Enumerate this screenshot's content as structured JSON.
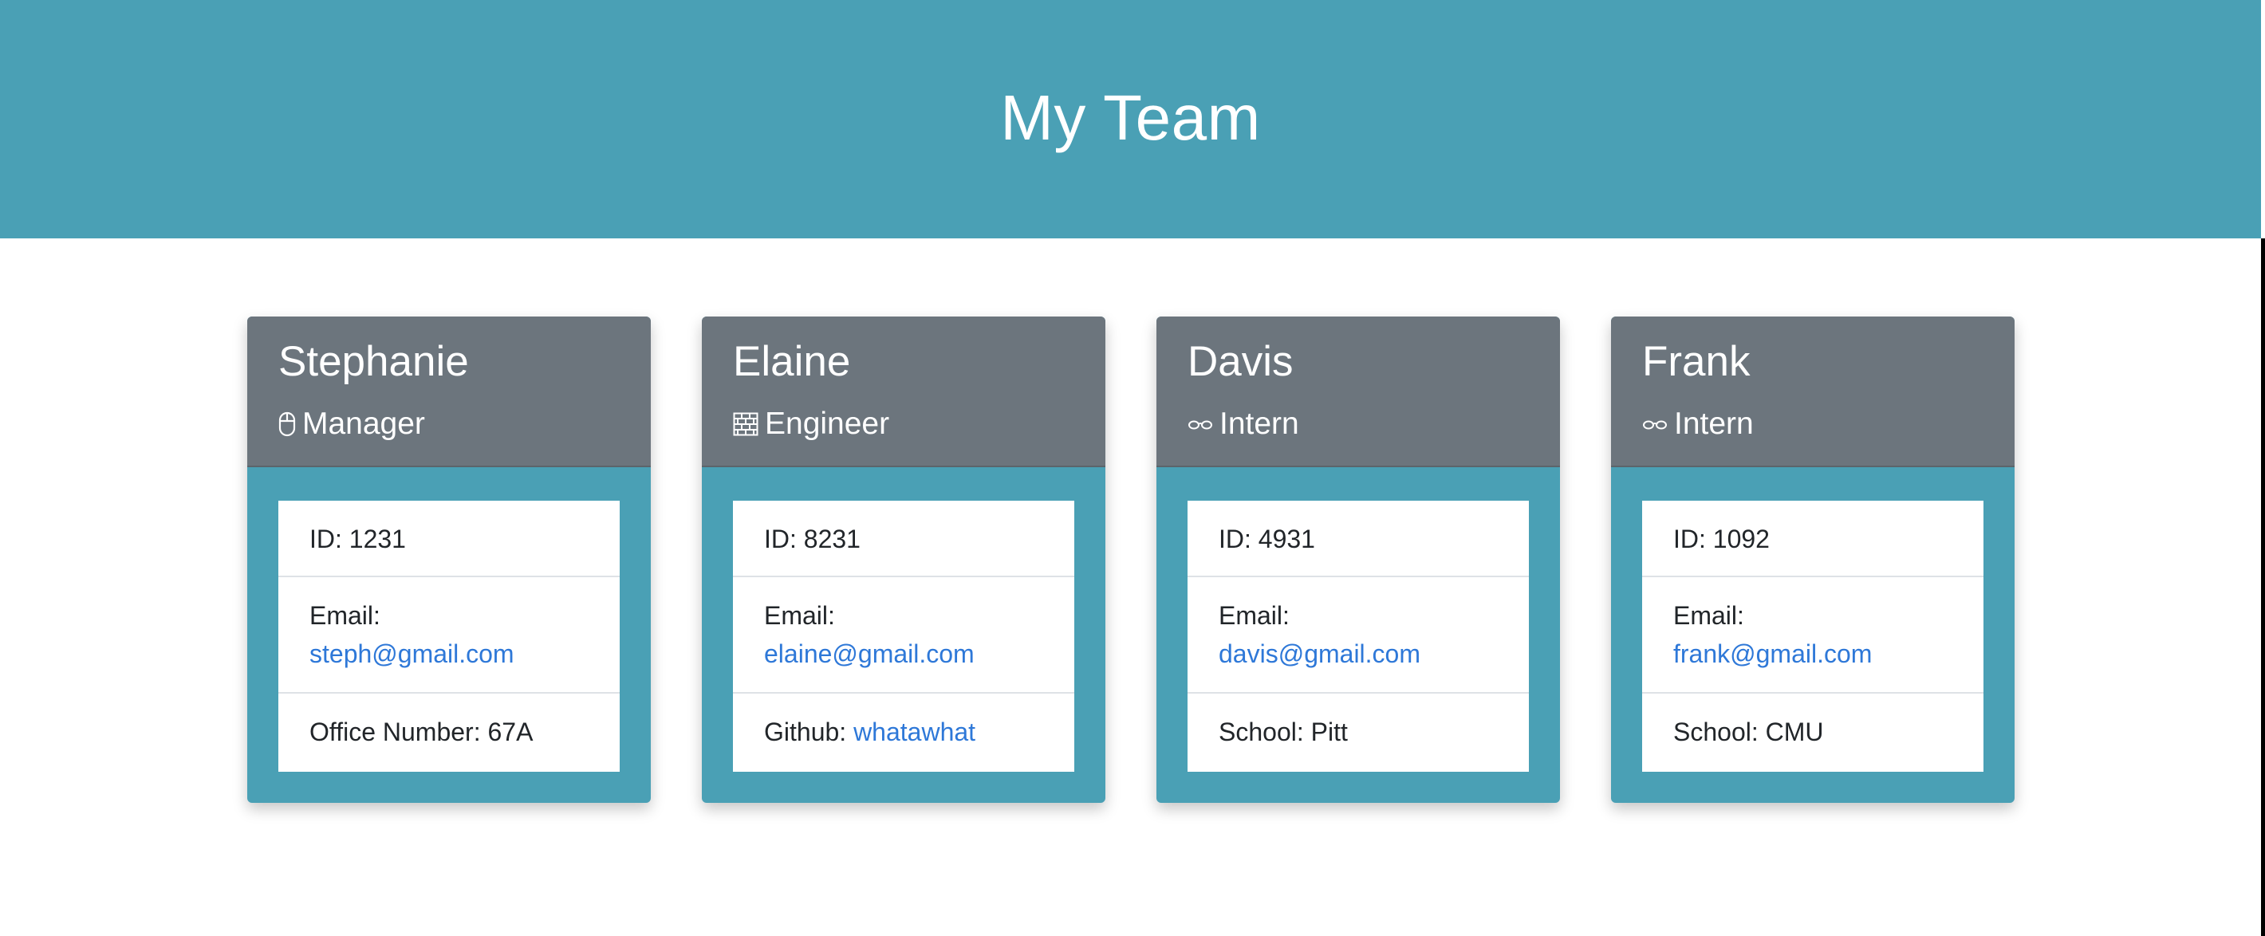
{
  "header": {
    "title": "My Team"
  },
  "employees": [
    {
      "name": "Stephanie",
      "role": "Manager",
      "role_icon": "mouse-icon",
      "id_label": "ID: 1231",
      "email_label": "Email:",
      "email": "steph@gmail.com",
      "extra_label": "Office Number: 67A",
      "extra_link": ""
    },
    {
      "name": "Elaine",
      "role": "Engineer",
      "role_icon": "brick-wall-icon",
      "id_label": "ID: 8231",
      "email_label": "Email:",
      "email": "elaine@gmail.com",
      "extra_label": "Github: ",
      "extra_link": "whatawhat"
    },
    {
      "name": "Davis",
      "role": "Intern",
      "role_icon": "glasses-icon",
      "id_label": "ID: 4931",
      "email_label": "Email:",
      "email": "davis@gmail.com",
      "extra_label": "School: Pitt",
      "extra_link": ""
    },
    {
      "name": "Frank",
      "role": "Intern",
      "role_icon": "glasses-icon",
      "id_label": "ID: 1092",
      "email_label": "Email:",
      "email": "frank@gmail.com",
      "extra_label": "School: CMU",
      "extra_link": ""
    }
  ],
  "colors": {
    "header_bg": "#4aa0b5",
    "card_header_bg": "#6c757d",
    "link": "#2e78d8"
  }
}
